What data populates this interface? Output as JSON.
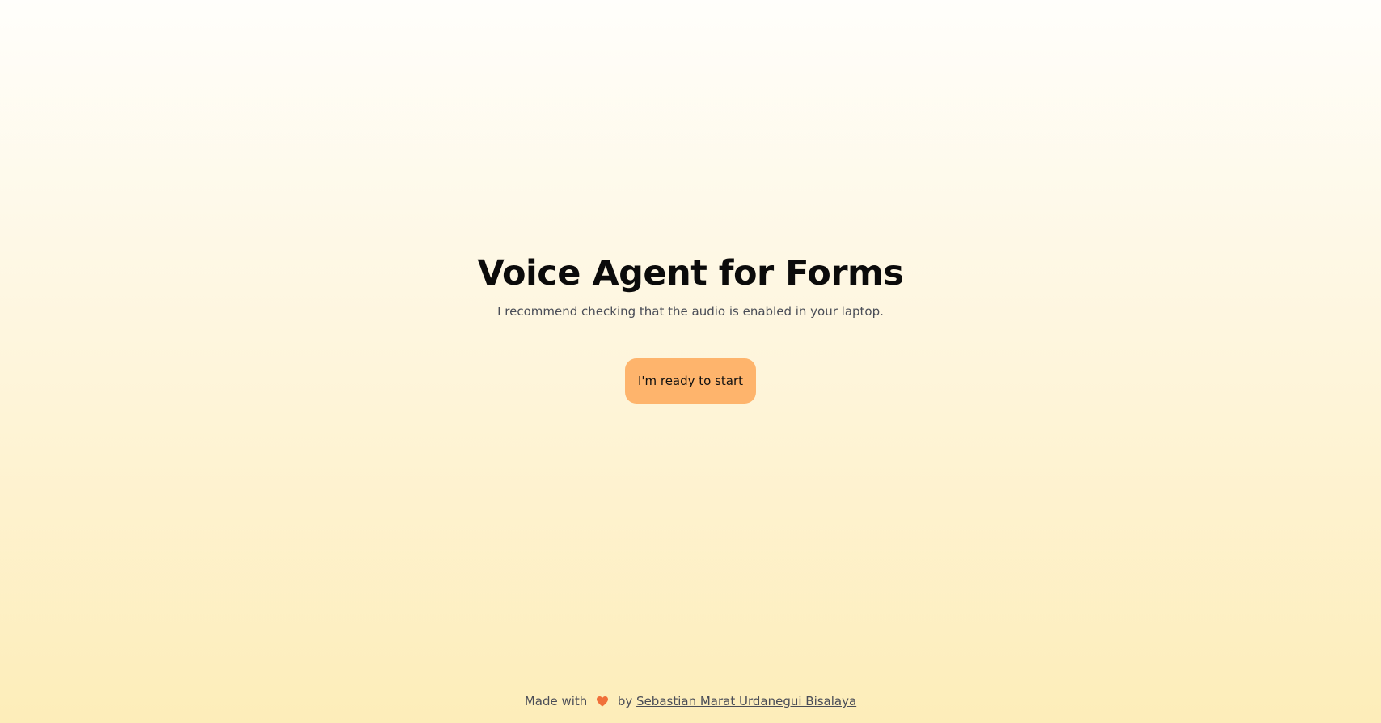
{
  "hero": {
    "title": "Voice Agent for Forms",
    "subtitle": "I recommend checking that the audio is enabled in your laptop.",
    "start_label": "I'm ready to start"
  },
  "footer": {
    "made_with": "Made with",
    "heart_icon": "heart-icon",
    "by": "by",
    "author": "Sebastian Marat Urdanegui Bisalaya"
  },
  "colors": {
    "button_bg": "#feb46c",
    "heart": "#f0703a",
    "background_top": "#fffefb",
    "background_bottom": "#fdedb9"
  }
}
